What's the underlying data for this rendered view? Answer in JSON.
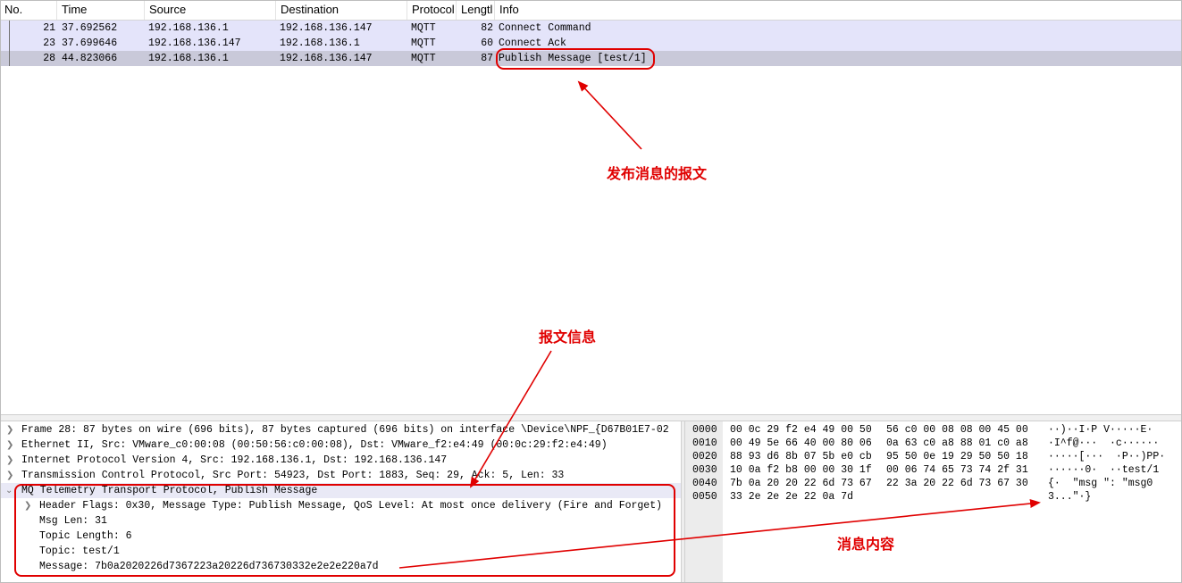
{
  "packet_list": {
    "columns": [
      "No.",
      "Time",
      "Source",
      "Destination",
      "Protocol",
      "Lengtl",
      "Info"
    ],
    "rows": [
      {
        "no": "21",
        "time": "37.692562",
        "source": "192.168.136.1",
        "destination": "192.168.136.147",
        "protocol": "MQTT",
        "length": "82",
        "info": "Connect Command"
      },
      {
        "no": "23",
        "time": "37.699646",
        "source": "192.168.136.147",
        "destination": "192.168.136.1",
        "protocol": "MQTT",
        "length": "60",
        "info": "Connect Ack"
      },
      {
        "no": "28",
        "time": "44.823066",
        "source": "192.168.136.1",
        "destination": "192.168.136.147",
        "protocol": "MQTT",
        "length": "87",
        "info": "Publish Message [test/1]"
      }
    ]
  },
  "details": {
    "frame": "Frame 28: 87 bytes on wire (696 bits), 87 bytes captured (696 bits) on interface \\Device\\NPF_{D67B01E7-02",
    "ethernet": "Ethernet II, Src: VMware_c0:00:08 (00:50:56:c0:00:08), Dst: VMware_f2:e4:49 (00:0c:29:f2:e4:49)",
    "ip": "Internet Protocol Version 4, Src: 192.168.136.1, Dst: 192.168.136.147",
    "tcp": "Transmission Control Protocol, Src Port: 54923, Dst Port: 1883, Seq: 29, Ack: 5, Len: 33",
    "mqtt": "MQ Telemetry Transport Protocol, Publish Message",
    "header_flags": "Header Flags: 0x30, Message Type: Publish Message, QoS Level: At most once delivery (Fire and Forget)",
    "msg_len": "Msg Len: 31",
    "topic_length": "Topic Length: 6",
    "topic": "Topic: test/1",
    "message": "Message: 7b0a2020226d7367223a20226d736730332e2e2e220a7d"
  },
  "hex_dump": [
    {
      "offset": "0000",
      "hex1": "00 0c 29 f2 e4 49 00 50",
      "hex2": "56 c0 00 08 08 00 45 00",
      "ascii": "··)··I·P V·····E·"
    },
    {
      "offset": "0010",
      "hex1": "00 49 5e 66 40 00 80 06",
      "hex2": "0a 63 c0 a8 88 01 c0 a8",
      "ascii": "·I^f@···  ·c······"
    },
    {
      "offset": "0020",
      "hex1": "88 93 d6 8b 07 5b e0 cb",
      "hex2": "95 50 0e 19 29 50 50 18",
      "ascii": "·····[···  ·P··)PP·"
    },
    {
      "offset": "0030",
      "hex1": "10 0a f2 b8 00 00 30 1f",
      "hex2": "00 06 74 65 73 74 2f 31",
      "ascii": "······0·  ··test/1"
    },
    {
      "offset": "0040",
      "hex1": "7b 0a 20 20 22 6d 73 67",
      "hex2": "22 3a 20 22 6d 73 67 30",
      "ascii": "{·  \"msg \": \"msg0"
    },
    {
      "offset": "0050",
      "hex1": "33 2e 2e 2e 22 0a 7d",
      "hex2": "",
      "ascii": "3...\"·}"
    }
  ],
  "annotations": {
    "publish_packet": "发布消息的报文",
    "packet_info": "报文信息",
    "message_content": "消息内容"
  },
  "colors": {
    "annotation": "#e00000",
    "row_highlight": "#e4e4fa",
    "row_selected": "#c9c9d9"
  }
}
